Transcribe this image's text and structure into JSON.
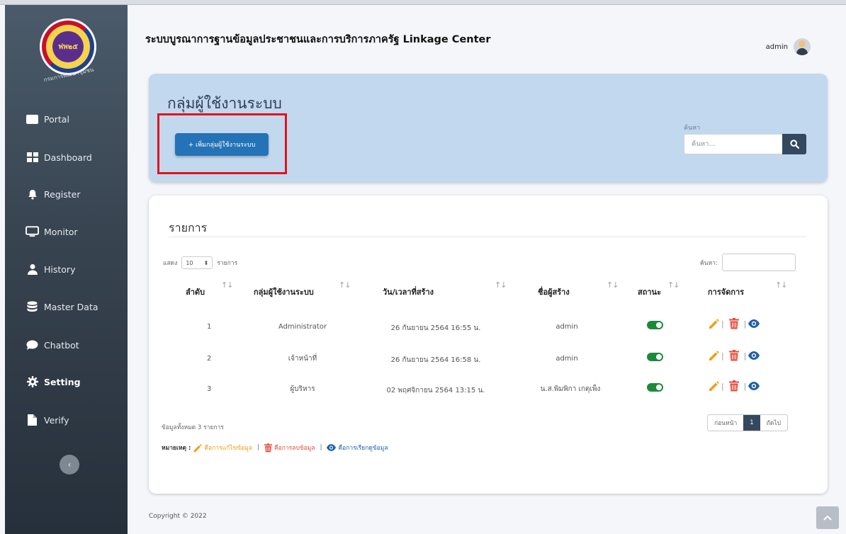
{
  "app": {
    "title": "ระบบบูรณาการฐานข้อมูลประชาชนและการบริการภาครัฐ Linkage Center",
    "user": "admin",
    "logo_text": "ฟพ๒๕",
    "logo_caption": "กรมการพัฒนาชุมชน"
  },
  "sidebar": {
    "items": [
      {
        "label": "Portal",
        "icon": "portal-icon"
      },
      {
        "label": "Dashboard",
        "icon": "dashboard-icon"
      },
      {
        "label": "Register",
        "icon": "bell-icon"
      },
      {
        "label": "Monitor",
        "icon": "monitor-icon"
      },
      {
        "label": "History",
        "icon": "user-icon"
      },
      {
        "label": "Master Data",
        "icon": "database-icon"
      },
      {
        "label": "Chatbot",
        "icon": "chat-icon"
      },
      {
        "label": "Setting",
        "icon": "gear-icon",
        "active": true
      },
      {
        "label": "Verify",
        "icon": "file-icon"
      }
    ],
    "collapse_glyph": "‹"
  },
  "top_panel": {
    "title": "กลุ่มผู้ใช้งานระบบ",
    "add_button": "+ เพิ่มกลุ่มผู้ใช้งานระบบ",
    "search_label": "ค้นหา",
    "search_placeholder": "ค้นหา..."
  },
  "list": {
    "title": "รายการ",
    "show_prefix": "แสดง",
    "page_size": "10",
    "show_suffix": "รายการ",
    "search_label": "ค้นหา:",
    "columns": [
      "ลำดับ",
      "กลุ่มผู้ใช้งานระบบ",
      "วัน/เวลาที่สร้าง",
      "ชื่อผู้สร้าง",
      "สถานะ",
      "การจัดการ"
    ],
    "sort_glyph": "↑↓",
    "rows": [
      {
        "no": "1",
        "group": "Administrator",
        "created": "26 กันยายน 2564 16:55 น.",
        "creator": "admin",
        "status": "on"
      },
      {
        "no": "2",
        "group": "เจ้าหน้าที่",
        "created": "26 กันยายน 2564 16:58 น.",
        "creator": "admin",
        "status": "on"
      },
      {
        "no": "3",
        "group": "ผู้บริหาร",
        "created": "02 พฤศจิกายน 2564 13:15 น.",
        "creator": "น.ส.พิมพิกา เกตุเพ็ง",
        "status": "on"
      }
    ],
    "total": "ข้อมูลทั้งหมด 3 รายการ",
    "pager": {
      "prev": "ก่อนหน้า",
      "current": "1",
      "next": "ถัดไป"
    },
    "legend": {
      "label": "หมายเหตุ :",
      "edit": "คือการแก้ไขข้อมูล",
      "delete": "คือการลบข้อมูล",
      "view": "คือการเรียกดูข้อมูล",
      "separator": "|"
    }
  },
  "footer": {
    "copyright": "Copyright © 2022"
  },
  "colors": {
    "sidebar": "#37434f",
    "accent_blue": "#2573b7",
    "panel_blue": "#c2d8ef",
    "status_green": "#1c8a3a",
    "edit_orange": "#f39c12",
    "delete_red": "#e74c3c",
    "highlight_red": "#e0141b"
  }
}
